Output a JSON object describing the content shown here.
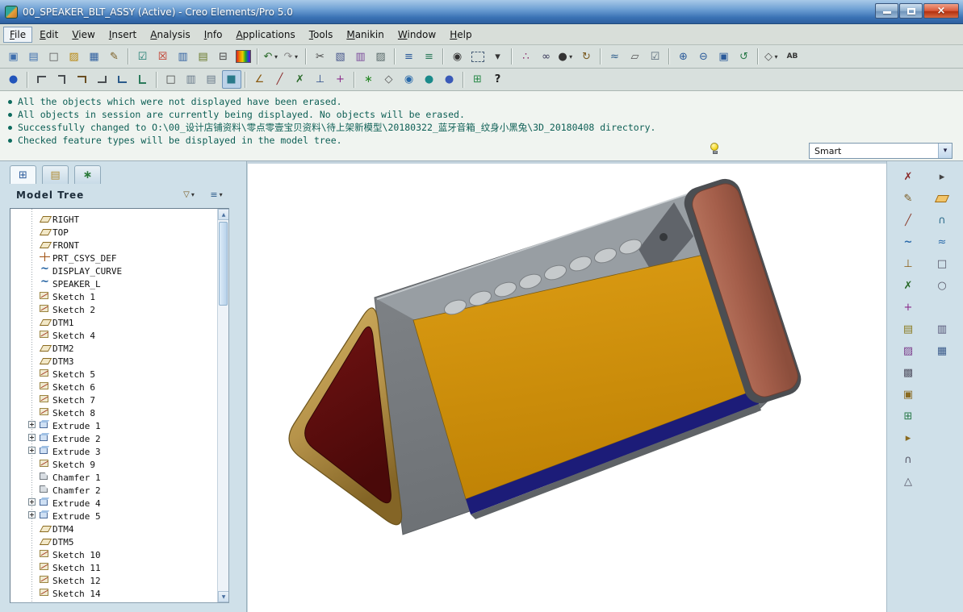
{
  "window": {
    "title": "00_SPEAKER_BLT_ASSY (Active) - Creo Elements/Pro 5.0"
  },
  "menubar": {
    "items": [
      {
        "label": "File",
        "active": true
      },
      {
        "label": "Edit"
      },
      {
        "label": "View"
      },
      {
        "label": "Insert"
      },
      {
        "label": "Analysis"
      },
      {
        "label": "Info"
      },
      {
        "label": "Applications"
      },
      {
        "label": "Tools"
      },
      {
        "label": "Manikin"
      },
      {
        "label": "Window"
      },
      {
        "label": "Help"
      }
    ]
  },
  "toolbar_row1": {
    "icons": [
      {
        "name": "select-working-dir-icon",
        "glyph": "▣",
        "c": "#3f6fae"
      },
      {
        "name": "open-last-session-icon",
        "glyph": "▤",
        "c": "#3f6fae"
      },
      {
        "name": "new-file-icon",
        "glyph": "□",
        "c": "#555555"
      },
      {
        "name": "open-file-icon",
        "glyph": "▨",
        "c": "#b8860b"
      },
      {
        "name": "save-file-icon",
        "glyph": "▦",
        "c": "#2f5fa0"
      },
      {
        "name": "save-copy-icon",
        "glyph": "✎",
        "c": "#7a5c20"
      },
      {
        "sep": true
      },
      {
        "name": "display-check-icon",
        "glyph": "☑",
        "c": "#1b7a6e"
      },
      {
        "name": "erase-display-icon",
        "glyph": "☒",
        "c": "#c03020"
      },
      {
        "name": "save-display-icon",
        "glyph": "▥",
        "c": "#2f5fa0"
      },
      {
        "name": "layers-icon",
        "glyph": "▤",
        "c": "#6a7a2a"
      },
      {
        "name": "print-icon",
        "glyph": "⊟",
        "c": "#444444"
      },
      {
        "name": "color-appearance-icon",
        "cls": "rainbow"
      },
      {
        "sep": true
      },
      {
        "name": "undo-icon",
        "glyph": "↶",
        "c": "#2a6a2a",
        "dd": true
      },
      {
        "name": "redo-icon",
        "glyph": "↷",
        "c": "#888888",
        "dd": true
      },
      {
        "sep": true
      },
      {
        "name": "cut-icon",
        "glyph": "✂",
        "c": "#444444"
      },
      {
        "name": "copy-icon",
        "glyph": "▧",
        "c": "#44548a"
      },
      {
        "name": "paste-icon",
        "glyph": "▥",
        "c": "#7a4a9a"
      },
      {
        "name": "paste-special-icon",
        "glyph": "▨",
        "c": "#556666"
      },
      {
        "sep": true
      },
      {
        "name": "feature-list-icon",
        "glyph": "≡",
        "c": "#2a5a9a"
      },
      {
        "name": "model-info-icon",
        "glyph": "≡",
        "c": "#2a7a5a"
      },
      {
        "sep": true
      },
      {
        "name": "find-icon",
        "glyph": "◉",
        "c": "#333333"
      },
      {
        "name": "select-box-icon",
        "cls": "selbox"
      },
      {
        "name": "select-options-icon",
        "glyph": "▾",
        "c": "#333333"
      },
      {
        "sep": true
      },
      {
        "name": "chain-select-icon",
        "glyph": "∴",
        "c": "#8a2a6a"
      },
      {
        "name": "view-glasses-icon",
        "glyph": "∞",
        "c": "#333355"
      },
      {
        "name": "shaded-sphere-icon",
        "glyph": "●",
        "c": "#333333",
        "dd": true
      },
      {
        "name": "spin-pan-icon",
        "glyph": "↻",
        "c": "#7a5a20"
      },
      {
        "sep": true
      },
      {
        "name": "layer-stack-icon",
        "glyph": "≈",
        "c": "#2a5a8a"
      },
      {
        "name": "drawing-icon",
        "glyph": "▱",
        "c": "#555555"
      },
      {
        "name": "annotate-icon",
        "glyph": "☑",
        "c": "#556677"
      },
      {
        "sep": true
      },
      {
        "name": "zoom-in-icon",
        "glyph": "⊕",
        "c": "#2a5a9a"
      },
      {
        "name": "zoom-out-icon",
        "glyph": "⊖",
        "c": "#2a5a9a"
      },
      {
        "name": "refit-icon",
        "glyph": "▣",
        "c": "#2a5a9a"
      },
      {
        "name": "repaint-icon",
        "glyph": "↺",
        "c": "#2a7a4a"
      },
      {
        "sep": true
      },
      {
        "name": "orient-mode-icon",
        "glyph": "◇",
        "c": "#555555",
        "dd": true
      },
      {
        "name": "rename-icon",
        "glyph": "AB",
        "c": "#333333",
        "cls": "small-text"
      }
    ]
  },
  "toolbar_row2": {
    "icons": [
      {
        "name": "regenerate-icon",
        "glyph": "●",
        "c": "#2255bb"
      },
      {
        "sep": true
      },
      {
        "name": "corner-display-icon-1",
        "shape": "elbow",
        "cls": "e1"
      },
      {
        "name": "corner-display-icon-2",
        "shape": "elbow",
        "cls": "e2"
      },
      {
        "name": "corner-display-icon-3",
        "shape": "elbow",
        "cls": "e3"
      },
      {
        "name": "corner-display-icon-4",
        "shape": "elbow",
        "cls": "e4"
      },
      {
        "name": "corner-display-icon-5",
        "shape": "elbow",
        "cls": "e5"
      },
      {
        "name": "corner-display-icon-6",
        "shape": "elbow",
        "cls": "e6"
      },
      {
        "sep": true
      },
      {
        "name": "wireframe-icon",
        "glyph": "□",
        "c": "#444444"
      },
      {
        "name": "hidden-line-icon",
        "glyph": "▥",
        "c": "#667788"
      },
      {
        "name": "no-hidden-icon",
        "glyph": "▤",
        "c": "#667788"
      },
      {
        "name": "shaded-icon",
        "glyph": "■",
        "c": "#2a7a8a",
        "active": true
      },
      {
        "sep": true
      },
      {
        "name": "datum-plane-toggle-icon",
        "glyph": "∠",
        "c": "#8a5a10"
      },
      {
        "name": "datum-axis-toggle-icon",
        "glyph": "╱",
        "c": "#8a2a2a"
      },
      {
        "name": "datum-point-toggle-icon",
        "glyph": "✗",
        "c": "#2a6a2a"
      },
      {
        "name": "csys-toggle-icon",
        "glyph": "⊥",
        "c": "#2a4a8a"
      },
      {
        "name": "spin-center-toggle-icon",
        "glyph": "+",
        "c": "#8a2a8a"
      },
      {
        "sep": true
      },
      {
        "name": "enhanced-realism-icon",
        "glyph": "∗",
        "c": "#2a8a2a"
      },
      {
        "name": "perspective-icon",
        "glyph": "◇",
        "c": "#555555"
      },
      {
        "name": "browser-icon",
        "glyph": "◉",
        "c": "#2a6aaa"
      },
      {
        "name": "render-icon",
        "glyph": "●",
        "c": "#1a8a8a"
      },
      {
        "name": "model-display-icon",
        "glyph": "●",
        "c": "#3a5ab8"
      },
      {
        "sep": true
      },
      {
        "name": "tree-structure-icon",
        "glyph": "⊞",
        "c": "#2a8a4a"
      },
      {
        "name": "context-help-icon",
        "glyph": "?",
        "c": "#222222",
        "cls": "bold"
      }
    ]
  },
  "messages": {
    "lines": [
      "All the objects which were not displayed have been erased.",
      "All objects in session are currently being displayed. No objects will be erased.",
      "Successfully changed to O:\\00_设计店铺资料\\零点零壹宝贝资料\\待上架新模型\\20180322_蓝牙音箱_纹身小黑兔\\3D_20180408 directory.",
      "Checked feature types will be displayed in the model tree."
    ]
  },
  "filter": {
    "label": "Smart"
  },
  "model_tree": {
    "title": "Model Tree",
    "items": [
      {
        "label": "RIGHT",
        "type": "plane"
      },
      {
        "label": "TOP",
        "type": "plane"
      },
      {
        "label": "FRONT",
        "type": "plane"
      },
      {
        "label": "PRT_CSYS_DEF",
        "type": "csys"
      },
      {
        "label": "DISPLAY_CURVE",
        "type": "curve"
      },
      {
        "label": "SPEAKER_L",
        "type": "curve"
      },
      {
        "label": "Sketch 1",
        "type": "sketch"
      },
      {
        "label": "Sketch 2",
        "type": "sketch"
      },
      {
        "label": "DTM1",
        "type": "plane"
      },
      {
        "label": "Sketch 4",
        "type": "sketch"
      },
      {
        "label": "DTM2",
        "type": "plane"
      },
      {
        "label": "DTM3",
        "type": "plane"
      },
      {
        "label": "Sketch 5",
        "type": "sketch"
      },
      {
        "label": "Sketch 6",
        "type": "sketch"
      },
      {
        "label": "Sketch 7",
        "type": "sketch"
      },
      {
        "label": "Sketch 8",
        "type": "sketch"
      },
      {
        "label": "Extrude 1",
        "type": "extrude",
        "expandable": true
      },
      {
        "label": "Extrude 2",
        "type": "extrude",
        "expandable": true
      },
      {
        "label": "Extrude 3",
        "type": "extrude",
        "expandable": true
      },
      {
        "label": "Sketch 9",
        "type": "sketch"
      },
      {
        "label": "Chamfer 1",
        "type": "chamfer"
      },
      {
        "label": "Chamfer 2",
        "type": "chamfer"
      },
      {
        "label": "Extrude 4",
        "type": "extrude",
        "expandable": true
      },
      {
        "label": "Extrude 5",
        "type": "extrude",
        "expandable": true
      },
      {
        "label": "DTM4",
        "type": "plane"
      },
      {
        "label": "DTM5",
        "type": "plane"
      },
      {
        "label": "Sketch 10",
        "type": "sketch"
      },
      {
        "label": "Sketch 11",
        "type": "sketch"
      },
      {
        "label": "Sketch 12",
        "type": "sketch"
      },
      {
        "label": "Sketch 14",
        "type": "sketch"
      }
    ]
  },
  "right_toolbar": {
    "icons": [
      {
        "name": "datum-point-tool-icon",
        "glyph": "✗",
        "c": "#8a2a2a"
      },
      {
        "name": "flyout-arrow-icon",
        "glyph": "▸",
        "c": "#444444"
      },
      {
        "name": "sketch-tool-icon",
        "glyph": "✎",
        "c": "#7a5a20"
      },
      {
        "name": "datum-plane-tool-icon",
        "shape": "pgram"
      },
      {
        "name": "datum-axis-tool-icon",
        "glyph": "╱",
        "c": "#8a3a2a"
      },
      {
        "name": "arc-tool-icon",
        "glyph": "∩",
        "c": "#2a6a8a"
      },
      {
        "name": "curve-tool-icon",
        "glyph": "~",
        "c": "#2a6aaa",
        "cls": "bold"
      },
      {
        "name": "spline-tool-icon",
        "glyph": "≈",
        "c": "#2a6aaa"
      },
      {
        "name": "csys-tool-icon",
        "glyph": "⊥",
        "c": "#8a5a10"
      },
      {
        "name": "rect-tool-icon",
        "glyph": "□",
        "c": "#555566"
      },
      {
        "name": "point-tool-icon",
        "glyph": "✗",
        "c": "#2a6a2a"
      },
      {
        "name": "cylinder-tool-icon",
        "glyph": "○",
        "c": "#555566"
      },
      {
        "name": "offset-point-icon",
        "glyph": "+",
        "c": "#8a2a8a"
      },
      {
        "blank": true
      },
      {
        "name": "layer-copy-icon",
        "glyph": "▤",
        "c": "#8a7a20"
      },
      {
        "name": "mirror-tool-icon",
        "glyph": "▥",
        "c": "#555577"
      },
      {
        "name": "palette-tool-icon",
        "glyph": "▨",
        "c": "#7a3a8a"
      },
      {
        "name": "grid-tool-icon",
        "glyph": "▦",
        "c": "#3a5a8a"
      },
      {
        "name": "stack-tool-icon",
        "glyph": "▩",
        "c": "#555566"
      },
      {
        "blank": true
      },
      {
        "name": "copy-geom-icon",
        "glyph": "▣",
        "c": "#8a6a20"
      },
      {
        "blank": true
      },
      {
        "name": "publish-geom-icon",
        "glyph": "⊞",
        "c": "#2a7a4a"
      },
      {
        "blank": true
      },
      {
        "name": "insert-here-icon",
        "glyph": "▸",
        "c": "#8a6a20"
      },
      {
        "blank": true
      },
      {
        "name": "round-tool-icon",
        "glyph": "∩",
        "c": "#555566"
      },
      {
        "blank": true
      },
      {
        "name": "draft-tool-icon",
        "glyph": "△",
        "c": "#555566"
      },
      {
        "blank": true
      }
    ]
  },
  "colors": {
    "speaker_face_red": "#5c0d0d",
    "speaker_rim_gold": "#c2a24e",
    "speaker_panel_orange": "#d4920e",
    "speaker_base_navy": "#1c1c78",
    "speaker_body_gray": "#787c80",
    "speaker_cap_brown": "#a86048",
    "titlebar_blue": "#3a72b4",
    "message_text_teal": "#0d5f55"
  }
}
